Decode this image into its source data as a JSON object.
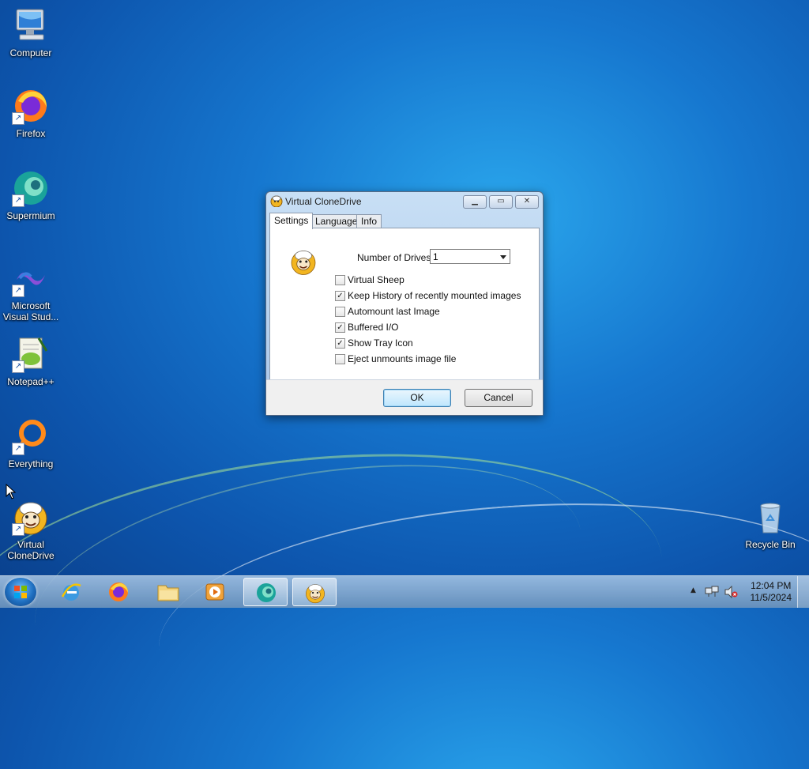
{
  "desktop": {
    "icons": [
      {
        "label": "Computer"
      },
      {
        "label": "Firefox"
      },
      {
        "label": "Supermium"
      },
      {
        "label_line1": "Microsoft",
        "label_line2": "Visual Stud..."
      },
      {
        "label": "Notepad++"
      },
      {
        "label": "Everything"
      },
      {
        "label_line1": "Virtual",
        "label_line2": "CloneDrive"
      },
      {
        "label": "Recycle Bin"
      }
    ]
  },
  "dialog": {
    "title": "Virtual CloneDrive",
    "tabs": [
      "Settings",
      "Language",
      "Info"
    ],
    "active_tab": "Settings",
    "drives_label": "Number of Drives:",
    "drives_value": "1",
    "options": [
      {
        "label": "Virtual Sheep",
        "checked": false
      },
      {
        "label": "Keep History of recently mounted images",
        "checked": true
      },
      {
        "label": "Automount last Image",
        "checked": false
      },
      {
        "label": "Buffered I/O",
        "checked": true
      },
      {
        "label": "Show Tray Icon",
        "checked": true
      },
      {
        "label": "Eject unmounts image file",
        "checked": false
      }
    ],
    "ok_label": "OK",
    "cancel_label": "Cancel"
  },
  "taskbar": {
    "time": "12:04 PM",
    "date": "11/5/2024"
  },
  "colors": {
    "desktop_blue": "#1677cf",
    "taskbar": "#8fb3d6",
    "dialog_frame": "#b8d2ee"
  }
}
